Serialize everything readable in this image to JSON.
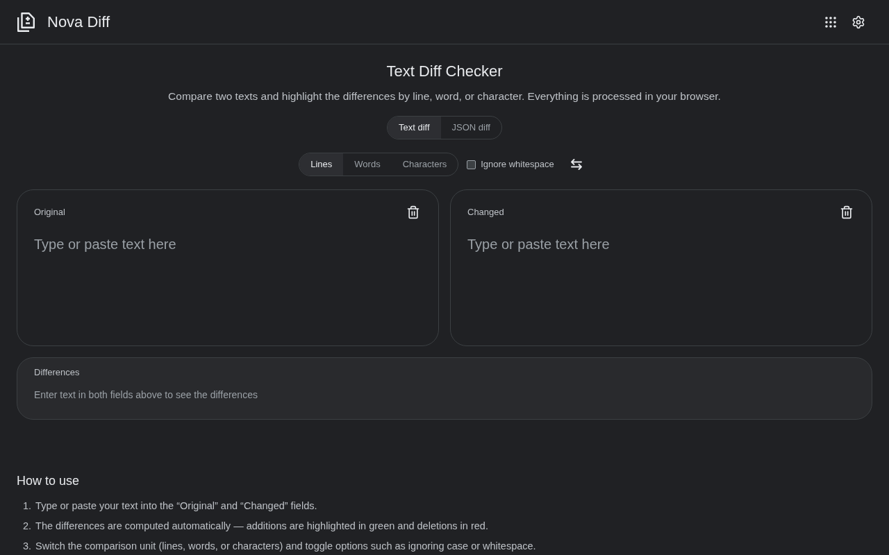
{
  "header": {
    "title": "Nova Diff"
  },
  "intro": {
    "title": "Text Diff Checker",
    "subtitle": "Compare two texts and highlight the differences by line, word, or character. Everything is processed in your browser."
  },
  "diff_types": [
    {
      "label": "Text diff",
      "selected": true
    },
    {
      "label": "JSON diff",
      "selected": false
    }
  ],
  "units": [
    {
      "label": "Lines",
      "selected": true
    },
    {
      "label": "Words",
      "selected": false
    },
    {
      "label": "Characters",
      "selected": false
    }
  ],
  "ignore_whitespace": {
    "label": "Ignore whitespace",
    "checked": false
  },
  "editors": [
    {
      "label": "Original",
      "placeholder": "Type or paste text here"
    },
    {
      "label": "Changed",
      "placeholder": "Type or paste text here"
    }
  ],
  "differences": {
    "label": "Differences",
    "message": "Enter text in both fields above to see the differences"
  },
  "how_to_use": {
    "title": "How to use",
    "steps": [
      {
        "number": "1.",
        "text": "Type or paste your text into the “Original” and “Changed” fields."
      },
      {
        "number": "2.",
        "text": "The differences are computed automatically — additions are highlighted in green and deletions in red."
      },
      {
        "number": "3.",
        "text": "Switch the comparison unit (lines, words, or characters) and toggle options such as ignoring case or whitespace."
      }
    ]
  }
}
